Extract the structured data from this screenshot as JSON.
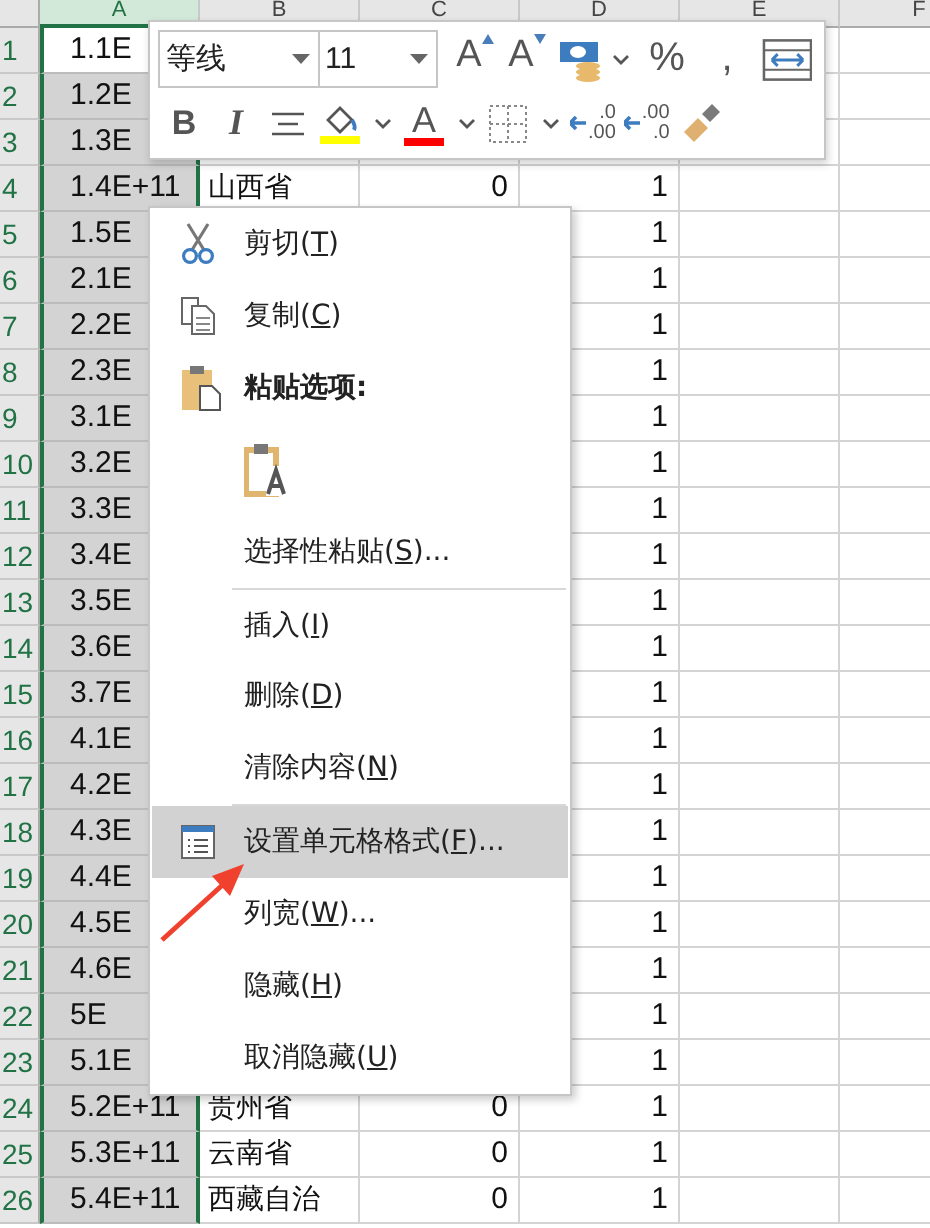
{
  "sheet": {
    "columns": [
      {
        "label": "A",
        "selected": true
      },
      {
        "label": "B",
        "selected": false
      },
      {
        "label": "C",
        "selected": false
      },
      {
        "label": "D",
        "selected": false
      },
      {
        "label": "E",
        "selected": false
      },
      {
        "label": "F",
        "selected": false
      }
    ],
    "rows": [
      {
        "number": "1",
        "active": true,
        "col_a": "1.1E"
      },
      {
        "number": "2",
        "active": false,
        "col_a": "1.2E"
      },
      {
        "number": "3",
        "active": false,
        "col_a": "1.3E"
      },
      {
        "number": "4",
        "active": false,
        "col_a": "1.4E+11",
        "col_b": "山西省",
        "col_c": "0",
        "col_d": "1"
      },
      {
        "number": "5",
        "active": false,
        "col_a": "1.5E",
        "col_d": "1"
      },
      {
        "number": "6",
        "active": false,
        "col_a": "2.1E",
        "col_d": "1"
      },
      {
        "number": "7",
        "active": false,
        "col_a": "2.2E",
        "col_d": "1"
      },
      {
        "number": "8",
        "active": false,
        "col_a": "2.3E",
        "col_d": "1"
      },
      {
        "number": "9",
        "active": false,
        "col_a": "3.1E",
        "col_d": "1"
      },
      {
        "number": "10",
        "active": false,
        "col_a": "3.2E",
        "col_d": "1"
      },
      {
        "number": "11",
        "active": false,
        "col_a": "3.3E",
        "col_d": "1"
      },
      {
        "number": "12",
        "active": false,
        "col_a": "3.4E",
        "col_d": "1"
      },
      {
        "number": "13",
        "active": false,
        "col_a": "3.5E",
        "col_d": "1"
      },
      {
        "number": "14",
        "active": false,
        "col_a": "3.6E",
        "col_d": "1"
      },
      {
        "number": "15",
        "active": false,
        "col_a": "3.7E",
        "col_d": "1"
      },
      {
        "number": "16",
        "active": false,
        "col_a": "4.1E",
        "col_d": "1"
      },
      {
        "number": "17",
        "active": false,
        "col_a": "4.2E",
        "col_d": "1"
      },
      {
        "number": "18",
        "active": false,
        "col_a": "4.3E",
        "col_d": "1"
      },
      {
        "number": "19",
        "active": false,
        "col_a": "4.4E",
        "col_d": "1"
      },
      {
        "number": "20",
        "active": false,
        "col_a": "4.5E",
        "col_d": "1"
      },
      {
        "number": "21",
        "active": false,
        "col_a": "4.6E",
        "col_d": "1"
      },
      {
        "number": "22",
        "active": false,
        "col_a": "5E",
        "col_d": "1"
      },
      {
        "number": "23",
        "active": false,
        "col_a": "5.1E",
        "col_d": "1"
      },
      {
        "number": "24",
        "active": false,
        "col_a": "5.2E+11",
        "col_b": "贵州省",
        "col_c": "0",
        "col_d": "1"
      },
      {
        "number": "25",
        "active": false,
        "col_a": "5.3E+11",
        "col_b": "云南省",
        "col_c": "0",
        "col_d": "1"
      },
      {
        "number": "26",
        "active": false,
        "col_a": "5.4E+11",
        "col_b": "西藏自治",
        "col_c": "0",
        "col_d": "1"
      }
    ]
  },
  "mini_toolbar": {
    "font_field": {
      "value": "等线"
    },
    "size_field": {
      "value": "11"
    },
    "row_1": [
      {
        "kind": "font-grow",
        "label": "A"
      },
      {
        "kind": "font-shrink",
        "label": "A"
      },
      {
        "kind": "accounting"
      },
      {
        "kind": "caret"
      },
      {
        "kind": "text",
        "label": "%"
      },
      {
        "kind": "text",
        "label": ","
      },
      {
        "kind": "wrap"
      }
    ],
    "row_2": [
      {
        "kind": "bold",
        "label": "B"
      },
      {
        "kind": "italic",
        "label": "I"
      },
      {
        "kind": "align-center"
      },
      {
        "kind": "fill-color",
        "color": "#ffff00"
      },
      {
        "kind": "caret"
      },
      {
        "kind": "font-color",
        "label": "A",
        "color": "#ff0000"
      },
      {
        "kind": "caret"
      },
      {
        "kind": "borders"
      },
      {
        "kind": "caret"
      },
      {
        "kind": "decimal",
        "top": ".0",
        "bottom": ".00"
      },
      {
        "kind": "decimal",
        "top": ".00",
        "bottom": ".0"
      },
      {
        "kind": "format-painter"
      }
    ]
  },
  "context_menu": [
    {
      "kind": "cut",
      "prefix": "剪切(",
      "key": "T",
      "suffix": ")",
      "selected": false
    },
    {
      "kind": "copy",
      "prefix": "复制(",
      "key": "C",
      "suffix": ")",
      "selected": false
    },
    {
      "kind": "paste-header",
      "label": "粘贴选项:"
    },
    {
      "kind": "paste-options"
    },
    {
      "kind": "plain",
      "prefix": "选择性粘贴(",
      "key": "S",
      "suffix": ")...",
      "selected": false
    },
    {
      "kind": "separator"
    },
    {
      "kind": "plain",
      "prefix": "插入(",
      "key": "I",
      "suffix": ")",
      "selected": false
    },
    {
      "kind": "plain",
      "prefix": "删除(",
      "key": "D",
      "suffix": ")",
      "selected": false
    },
    {
      "kind": "plain",
      "prefix": "清除内容(",
      "key": "N",
      "suffix": ")",
      "selected": false
    },
    {
      "kind": "separator"
    },
    {
      "kind": "format",
      "prefix": "设置单元格格式(",
      "key": "F",
      "suffix": ")...",
      "selected": true
    },
    {
      "kind": "plain",
      "prefix": "列宽(",
      "key": "W",
      "suffix": ")...",
      "selected": false
    },
    {
      "kind": "plain",
      "prefix": "隐藏(",
      "key": "H",
      "suffix": ")",
      "selected": false
    },
    {
      "kind": "plain",
      "prefix": "取消隐藏(",
      "key": "U",
      "suffix": ")",
      "selected": false
    }
  ],
  "annotations": [
    {
      "kind": "arrow"
    }
  ]
}
